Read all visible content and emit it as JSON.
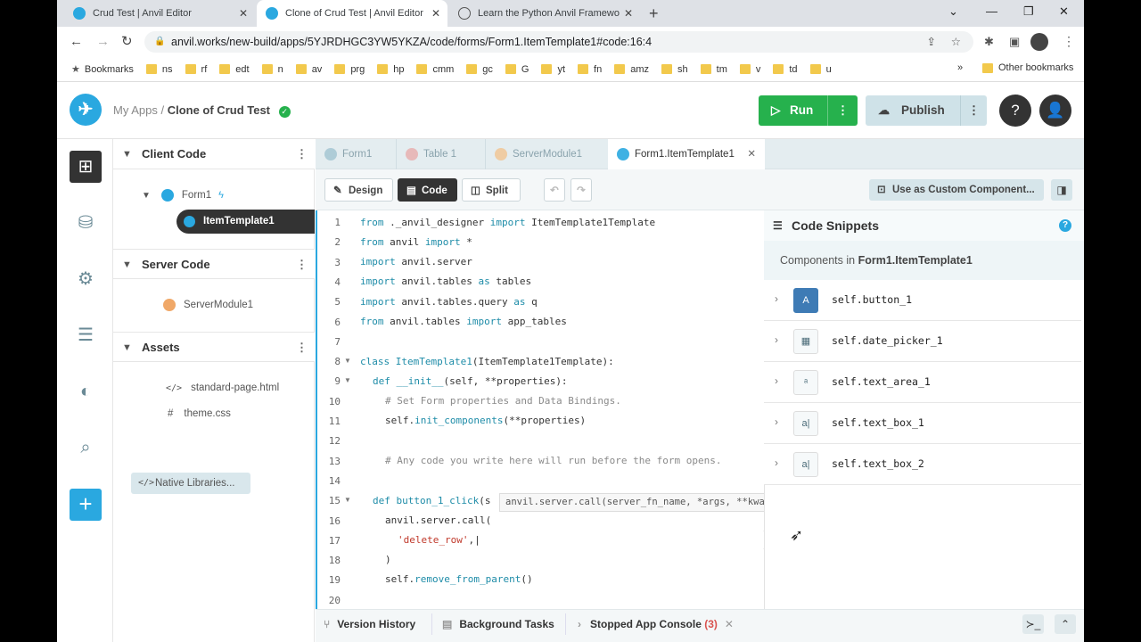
{
  "browser": {
    "tabs": [
      {
        "title": "Crud Test | Anvil Editor"
      },
      {
        "title": "Clone of Crud Test | Anvil Editor"
      },
      {
        "title": "Learn the Python Anvil Framewo"
      }
    ],
    "url": "anvil.works/new-build/apps/5YJRDHGC3YW5YKZA/code/forms/Form1.ItemTemplate1#code:16:4",
    "bookmarks": [
      "Bookmarks",
      "ns",
      "rf",
      "edt",
      "n",
      "av",
      "prg",
      "hp",
      "cmm",
      "gc",
      "G",
      "yt",
      "fn",
      "amz",
      "sh",
      "tm",
      "v",
      "td",
      "u"
    ],
    "other_bookmarks": "Other bookmarks",
    "more_bookmarks": "»"
  },
  "header": {
    "my_apps": "My Apps",
    "separator": " / ",
    "app_name": "Clone of Crud Test",
    "run_label": "Run",
    "publish_label": "Publish"
  },
  "sidebar": {
    "client_code": "Client Code",
    "form1": "Form1",
    "item_template": "ItemTemplate1",
    "server_code": "Server Code",
    "server_module": "ServerModule1",
    "assets": "Assets",
    "asset_files": [
      "standard-page.html",
      "theme.css"
    ],
    "native_libraries": "Native Libraries..."
  },
  "editor": {
    "tabs": [
      "Form1",
      "Table 1",
      "ServerModule1",
      "Form1.ItemTemplate1"
    ],
    "design_label": "Design",
    "code_label": "Code",
    "split_label": "Split",
    "use_as_custom": "Use as Custom Component...",
    "tooltip": "anvil.server.call(server_fn_name, *args, **kwargs)",
    "line_numbers": [
      "1",
      "2",
      "3",
      "4",
      "5",
      "6",
      "7",
      "8",
      "9",
      "10",
      "11",
      "12",
      "13",
      "14",
      "15",
      "16",
      "17",
      "18",
      "19",
      "20"
    ]
  },
  "snippets": {
    "title": "Code Snippets",
    "components_prefix": "Components in ",
    "form_name": "Form1.ItemTemplate1",
    "items": [
      {
        "label": "self.button_1",
        "icon": "button-icon"
      },
      {
        "label": "self.date_picker_1",
        "icon": "calendar-icon"
      },
      {
        "label": "self.text_area_1",
        "icon": "text-area-icon"
      },
      {
        "label": "self.text_box_1",
        "icon": "text-box-icon"
      },
      {
        "label": "self.text_box_2",
        "icon": "text-box-icon"
      }
    ]
  },
  "bottom": {
    "version_history": "Version History",
    "background_tasks": "Background Tasks",
    "stopped_console": "Stopped App Console",
    "console_count": "(3)"
  },
  "colors": {
    "accent": "#2aa8e0",
    "run_green": "#26b14d",
    "selected_item": "#333333"
  }
}
